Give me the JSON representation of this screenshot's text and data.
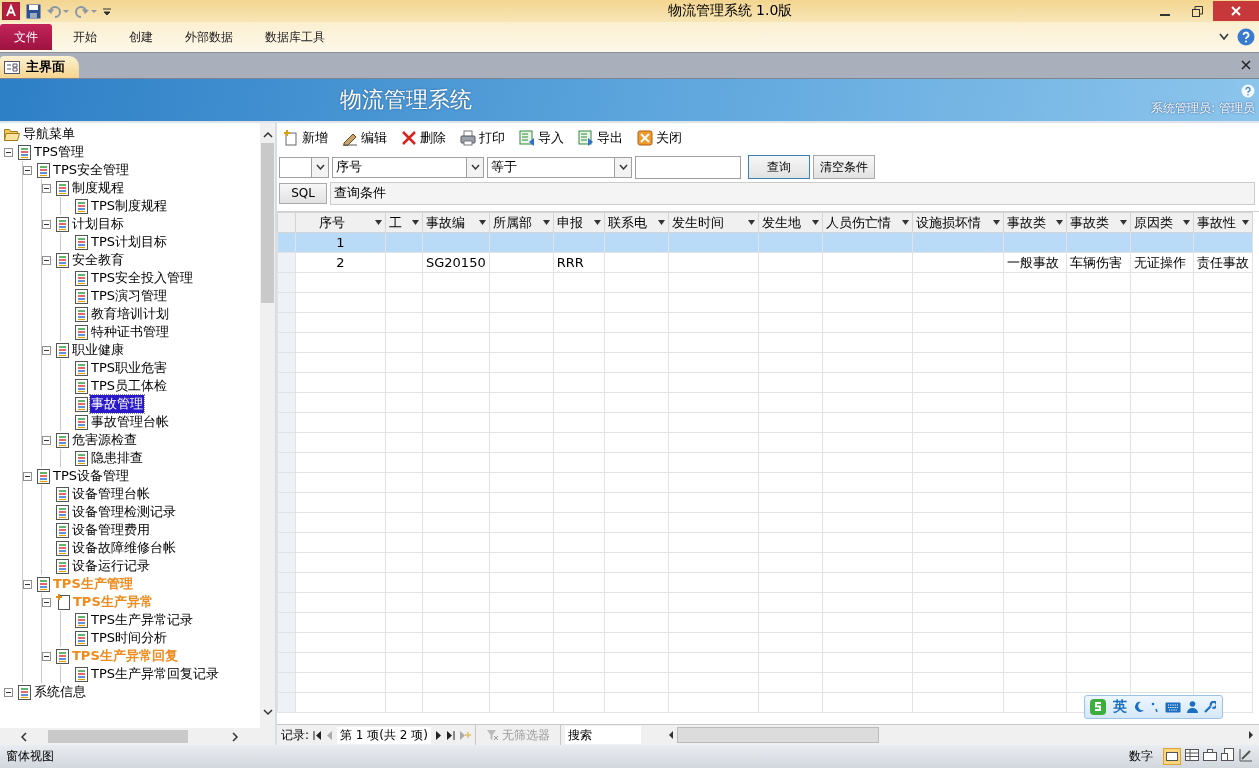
{
  "window": {
    "title": "物流管理系统 1.0版"
  },
  "ribbon_tabs": [
    {
      "label": "文件",
      "selected": true
    },
    {
      "label": "开始",
      "selected": false
    },
    {
      "label": "创建",
      "selected": false
    },
    {
      "label": "外部数据",
      "selected": false
    },
    {
      "label": "数据库工具",
      "selected": false
    }
  ],
  "document_tab": {
    "label": "主界面"
  },
  "banner": {
    "title": "物流管理系统",
    "user": "系统管理员: 管理员"
  },
  "nav_tree": {
    "root": "导航菜单",
    "items": [
      {
        "label": "TPS管理",
        "kind": "doc",
        "selected": false,
        "highlighted": false,
        "expanded": true,
        "children": [
          {
            "label": "TPS安全管理",
            "kind": "doc",
            "selected": false,
            "highlighted": false,
            "expanded": true,
            "children": [
              {
                "label": "制度规程",
                "kind": "doc",
                "selected": false,
                "highlighted": false,
                "expanded": true,
                "children": [
                  {
                    "label": "TPS制度规程",
                    "kind": "doc",
                    "selected": false,
                    "highlighted": false
                  }
                ]
              },
              {
                "label": "计划目标",
                "kind": "doc",
                "selected": false,
                "highlighted": false,
                "expanded": true,
                "children": [
                  {
                    "label": "TPS计划目标",
                    "kind": "doc",
                    "selected": false,
                    "highlighted": false
                  }
                ]
              },
              {
                "label": "安全教育",
                "kind": "doc",
                "selected": false,
                "highlighted": false,
                "expanded": true,
                "children": [
                  {
                    "label": "TPS安全投入管理",
                    "kind": "doc",
                    "selected": false,
                    "highlighted": false
                  },
                  {
                    "label": "TPS演习管理",
                    "kind": "doc",
                    "selected": false,
                    "highlighted": false
                  },
                  {
                    "label": "教育培训计划",
                    "kind": "doc",
                    "selected": false,
                    "highlighted": false
                  },
                  {
                    "label": "特种证书管理",
                    "kind": "doc",
                    "selected": false,
                    "highlighted": false
                  }
                ]
              },
              {
                "label": "职业健康",
                "kind": "doc",
                "selected": false,
                "highlighted": false,
                "expanded": true,
                "children": [
                  {
                    "label": "TPS职业危害",
                    "kind": "doc",
                    "selected": false,
                    "highlighted": false
                  },
                  {
                    "label": "TPS员工体检",
                    "kind": "doc",
                    "selected": false,
                    "highlighted": false
                  },
                  {
                    "label": "事故管理",
                    "kind": "doc",
                    "selected": true,
                    "highlighted": false
                  },
                  {
                    "label": "事故管理台帐",
                    "kind": "doc",
                    "selected": false,
                    "highlighted": false
                  }
                ]
              },
              {
                "label": "危害源检查",
                "kind": "doc",
                "selected": false,
                "highlighted": false,
                "expanded": true,
                "children": [
                  {
                    "label": "隐患排查",
                    "kind": "doc",
                    "selected": false,
                    "highlighted": false
                  }
                ]
              }
            ]
          },
          {
            "label": "TPS设备管理",
            "kind": "doc",
            "selected": false,
            "highlighted": false,
            "expanded": true,
            "children": [
              {
                "label": "设备管理台帐",
                "kind": "doc",
                "selected": false,
                "highlighted": false
              },
              {
                "label": "设备管理检测记录",
                "kind": "doc",
                "selected": false,
                "highlighted": false
              },
              {
                "label": "设备管理费用",
                "kind": "doc",
                "selected": false,
                "highlighted": false
              },
              {
                "label": "设备故障维修台帐",
                "kind": "doc",
                "selected": false,
                "highlighted": false
              },
              {
                "label": "设备运行记录",
                "kind": "doc",
                "selected": false,
                "highlighted": false
              }
            ]
          },
          {
            "label": "TPS生产管理",
            "kind": "doc",
            "selected": false,
            "highlighted": true,
            "expanded": true,
            "children": [
              {
                "label": "TPS生产异常",
                "kind": "new-page",
                "selected": false,
                "highlighted": true,
                "expanded": true,
                "children": [
                  {
                    "label": "TPS生产异常记录",
                    "kind": "doc",
                    "selected": false,
                    "highlighted": false
                  },
                  {
                    "label": "TPS时间分析",
                    "kind": "doc",
                    "selected": false,
                    "highlighted": false
                  }
                ]
              },
              {
                "label": "TPS生产异常回复",
                "kind": "doc",
                "selected": false,
                "highlighted": true,
                "expanded": true,
                "children": [
                  {
                    "label": "TPS生产异常回复记录",
                    "kind": "doc",
                    "selected": false,
                    "highlighted": false
                  }
                ]
              }
            ]
          }
        ]
      },
      {
        "label": "系统信息",
        "kind": "doc",
        "selected": false,
        "highlighted": false,
        "expanded": true
      }
    ]
  },
  "toolbar": [
    {
      "label": "新增",
      "kind": "new"
    },
    {
      "label": "编辑",
      "kind": "edit"
    },
    {
      "label": "删除",
      "kind": "delete"
    },
    {
      "label": "打印",
      "kind": "print"
    },
    {
      "label": "导入",
      "kind": "import"
    },
    {
      "label": "导出",
      "kind": "export"
    },
    {
      "label": "关闭",
      "kind": "close"
    }
  ],
  "filter": {
    "field": "序号",
    "operator": "等于",
    "buttons": [
      "查询",
      "清空条件"
    ]
  },
  "sql": {
    "button": "SQL",
    "condition": "查询条件"
  },
  "table": {
    "columns": [
      "序号",
      "工",
      "事故编",
      "所属部",
      "申报",
      "联系电",
      "发生时间",
      "发生地",
      "人员伤亡情",
      "设施损坏情",
      "事故类",
      "事故类",
      "原因类",
      "事故性"
    ],
    "rows": [
      {
        "selected": true,
        "cells": [
          "1",
          null,
          null,
          null,
          null,
          null,
          null,
          null,
          null,
          null,
          null,
          null,
          null,
          null
        ]
      },
      {
        "selected": false,
        "cells": [
          "2",
          null,
          "SG20150",
          null,
          "RRR",
          null,
          null,
          null,
          null,
          null,
          "一般事故",
          "车辆伤害",
          "无证操作",
          "责任事故"
        ]
      }
    ]
  },
  "record_nav": {
    "label": "记录:",
    "position": "第 1 项(共 2 项)",
    "filter": "无筛选器",
    "search_placeholder": "搜索"
  },
  "ime": {
    "mode": "英"
  },
  "status_bar": {
    "left": "窗体视图",
    "right": "数字"
  }
}
